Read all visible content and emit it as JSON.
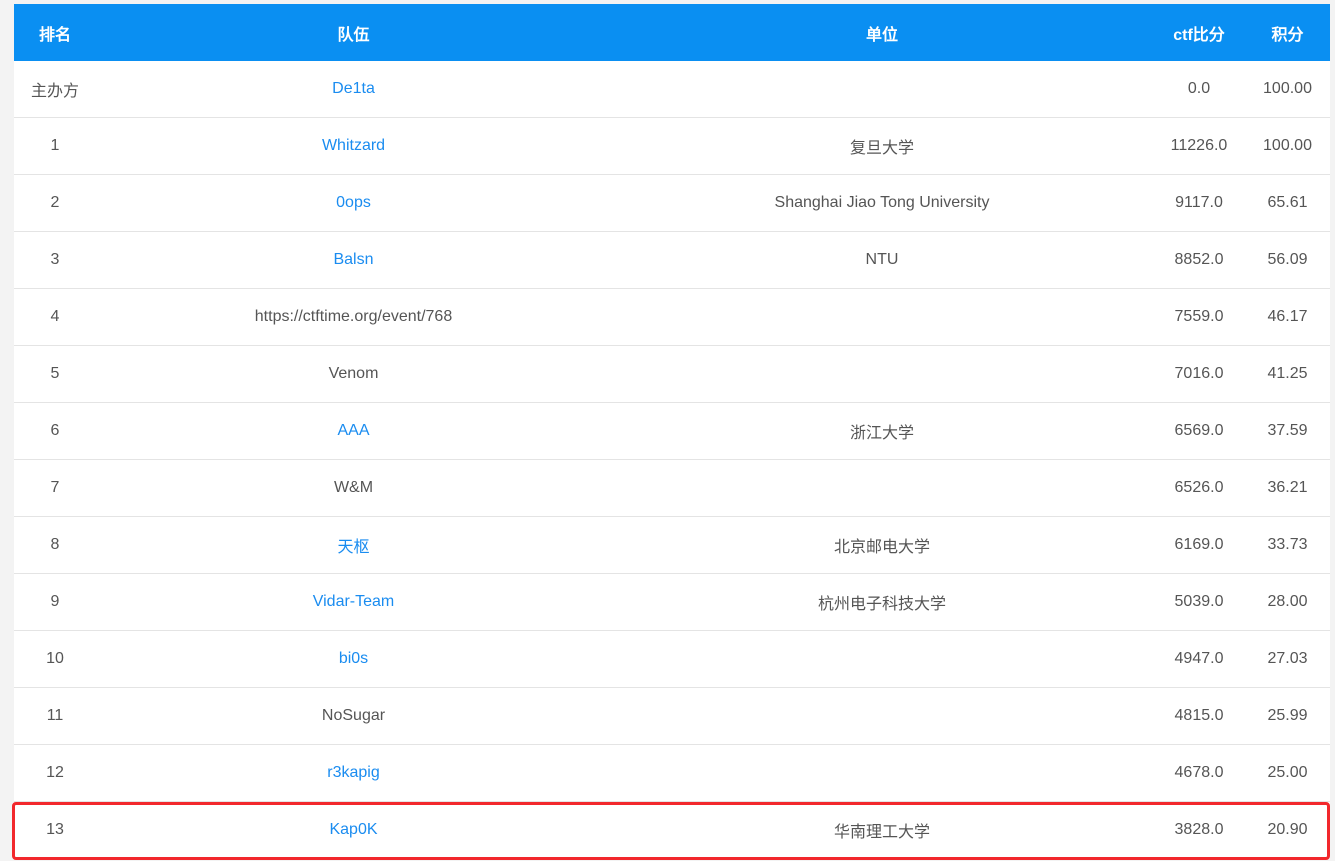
{
  "headers": {
    "rank": "排名",
    "team": "队伍",
    "unit": "单位",
    "ctf_score": "ctf比分",
    "points": "积分"
  },
  "rows": [
    {
      "rank": "主办方",
      "team": "De1ta",
      "team_linked": true,
      "unit": "",
      "ctf_score": "0.0",
      "points": "100.00"
    },
    {
      "rank": "1",
      "team": "Whitzard",
      "team_linked": true,
      "unit": "复旦大学",
      "ctf_score": "11226.0",
      "points": "100.00"
    },
    {
      "rank": "2",
      "team": "0ops",
      "team_linked": true,
      "unit": "Shanghai Jiao Tong University",
      "ctf_score": "9117.0",
      "points": "65.61"
    },
    {
      "rank": "3",
      "team": "Balsn",
      "team_linked": true,
      "unit": "NTU",
      "ctf_score": "8852.0",
      "points": "56.09"
    },
    {
      "rank": "4",
      "team": "https://ctftime.org/event/768",
      "team_linked": false,
      "unit": "",
      "ctf_score": "7559.0",
      "points": "46.17"
    },
    {
      "rank": "5",
      "team": "Venom",
      "team_linked": false,
      "unit": "",
      "ctf_score": "7016.0",
      "points": "41.25"
    },
    {
      "rank": "6",
      "team": "AAA",
      "team_linked": true,
      "unit": "浙江大学",
      "ctf_score": "6569.0",
      "points": "37.59"
    },
    {
      "rank": "7",
      "team": "W&M",
      "team_linked": false,
      "unit": "",
      "ctf_score": "6526.0",
      "points": "36.21"
    },
    {
      "rank": "8",
      "team": "天枢",
      "team_linked": true,
      "unit": "北京邮电大学",
      "ctf_score": "6169.0",
      "points": "33.73"
    },
    {
      "rank": "9",
      "team": "Vidar-Team",
      "team_linked": true,
      "unit": "杭州电子科技大学",
      "ctf_score": "5039.0",
      "points": "28.00"
    },
    {
      "rank": "10",
      "team": "bi0s",
      "team_linked": true,
      "unit": "",
      "ctf_score": "4947.0",
      "points": "27.03"
    },
    {
      "rank": "11",
      "team": "NoSugar",
      "team_linked": false,
      "unit": "",
      "ctf_score": "4815.0",
      "points": "25.99"
    },
    {
      "rank": "12",
      "team": "r3kapig",
      "team_linked": true,
      "unit": "",
      "ctf_score": "4678.0",
      "points": "25.00"
    },
    {
      "rank": "13",
      "team": "Kap0K",
      "team_linked": true,
      "unit": "华南理工大学",
      "ctf_score": "3828.0",
      "points": "20.90",
      "highlighted": true
    }
  ],
  "colors": {
    "header_bg": "#0a8ff2",
    "link": "#1a8cf0",
    "highlight_border": "#f2282c"
  }
}
